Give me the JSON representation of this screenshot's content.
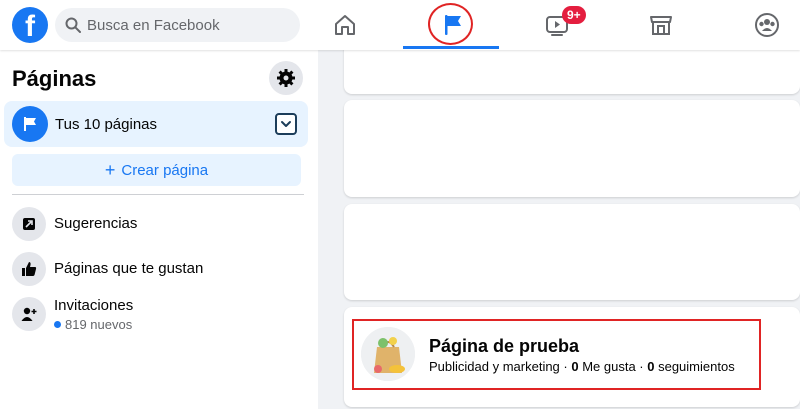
{
  "header": {
    "logo_letter": "f",
    "search_placeholder": "Busca en Facebook",
    "watch_badge": "9+",
    "colors": {
      "brand": "#1877f2",
      "badge": "#e41e3f",
      "annotation": "#e02424"
    }
  },
  "nav": {
    "tabs": [
      {
        "name": "home",
        "icon": "home-icon",
        "active": false
      },
      {
        "name": "pages",
        "icon": "flag-icon",
        "active": true
      },
      {
        "name": "watch",
        "icon": "video-icon",
        "active": false
      },
      {
        "name": "marketplace",
        "icon": "store-icon",
        "active": false
      },
      {
        "name": "groups",
        "icon": "groups-icon",
        "active": false
      }
    ]
  },
  "sidebar": {
    "title": "Páginas",
    "your_pages_label": "Tus 10 páginas",
    "create_label": "Crear página",
    "create_plus": "+",
    "items": [
      {
        "label": "Sugerencias",
        "icon": "suggestions-icon"
      },
      {
        "label": "Páginas que te gustan",
        "icon": "thumbs-up-icon"
      },
      {
        "label": "Invitaciones",
        "icon": "add-person-icon",
        "sub": "819 nuevos"
      }
    ]
  },
  "page_card": {
    "name": "Página de prueba",
    "category": "Publicidad y marketing",
    "sep1": " · ",
    "likes_count": "0",
    "likes_label": " Me gusta",
    "sep2": " · ",
    "followers_count": "0",
    "followers_label": " seguimientos"
  }
}
